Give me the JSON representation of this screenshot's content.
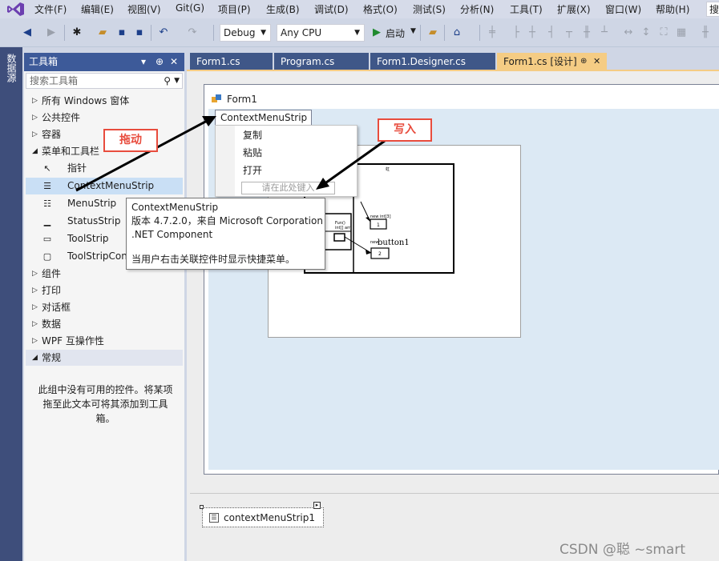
{
  "menubar": {
    "items": [
      "文件(F)",
      "编辑(E)",
      "视图(V)",
      "Git(G)",
      "项目(P)",
      "生成(B)",
      "调试(D)",
      "格式(O)",
      "测试(S)",
      "分析(N)",
      "工具(T)",
      "扩展(X)",
      "窗口(W)",
      "帮助(H)"
    ],
    "search_placeholder": "搜"
  },
  "toolbar": {
    "config": "Debug",
    "platform": "Any CPU",
    "start_label": "启动",
    "icons": [
      "back-icon",
      "forward-icon",
      "new-project-icon",
      "open-icon",
      "save-icon",
      "save-all-icon",
      "undo-icon",
      "redo-icon",
      "start-icon",
      "folder-icon",
      "browser-icon"
    ]
  },
  "side_strip": {
    "label": "数据源"
  },
  "toolbox": {
    "title": "工具箱",
    "pin": "↓ ⊕ ✕",
    "search_placeholder": "搜索工具箱",
    "categories": [
      {
        "label": "所有 Windows 窗体",
        "expanded": false
      },
      {
        "label": "公共控件",
        "expanded": false
      },
      {
        "label": "容器",
        "expanded": false
      },
      {
        "label": "菜单和工具栏",
        "expanded": true
      }
    ],
    "menu_items": [
      {
        "label": "指针",
        "icon": "pointer-icon",
        "glyph": "↖"
      },
      {
        "label": "ContextMenuStrip",
        "icon": "context-menu-strip-icon",
        "glyph": "☰"
      },
      {
        "label": "MenuStrip",
        "icon": "menu-strip-icon",
        "glyph": "☷"
      },
      {
        "label": "StatusStrip",
        "icon": "status-strip-icon",
        "glyph": "▁"
      },
      {
        "label": "ToolStrip",
        "icon": "tool-strip-icon",
        "glyph": "▭"
      },
      {
        "label": "ToolStripContainer",
        "icon": "tool-strip-container-icon",
        "glyph": "▢"
      }
    ],
    "categories_after": [
      {
        "label": "组件"
      },
      {
        "label": "打印"
      },
      {
        "label": "对话框"
      },
      {
        "label": "数据"
      },
      {
        "label": "WPF 互操作性"
      }
    ],
    "general": {
      "label": "常规"
    },
    "empty_message": "此组中没有可用的控件。将某项拖至此文本可将其添加到工具箱。"
  },
  "tabs": [
    {
      "label": "Form1.cs"
    },
    {
      "label": "Program.cs"
    },
    {
      "label": "Form1.Designer.cs"
    },
    {
      "label": "Form1.cs [设计]",
      "pin": "⊕",
      "close": "✕"
    }
  ],
  "form": {
    "title": "Form1",
    "context_menu_strip_label": "ContextMenuStrip",
    "context_items": [
      "复制",
      "粘贴",
      "打开"
    ],
    "context_input_placeholder": "请在此处键入"
  },
  "picture_diagram": {
    "labels": [
      "new int[3]",
      "Fun()",
      "int[] arr",
      "new",
      "button1",
      "1",
      "2"
    ]
  },
  "tooltip": {
    "line1": "ContextMenuStrip",
    "line2": "版本 4.7.2.0，来自 Microsoft Corporation",
    "line3": ".NET Component",
    "line4": "当用户右击关联控件时显示快捷菜单。"
  },
  "annotations": {
    "drag": "拖动",
    "write": "写入",
    "color": "#e84c3d"
  },
  "tray": {
    "item": "contextMenuStrip1"
  },
  "watermark": "CSDN @聪      ~smart"
}
